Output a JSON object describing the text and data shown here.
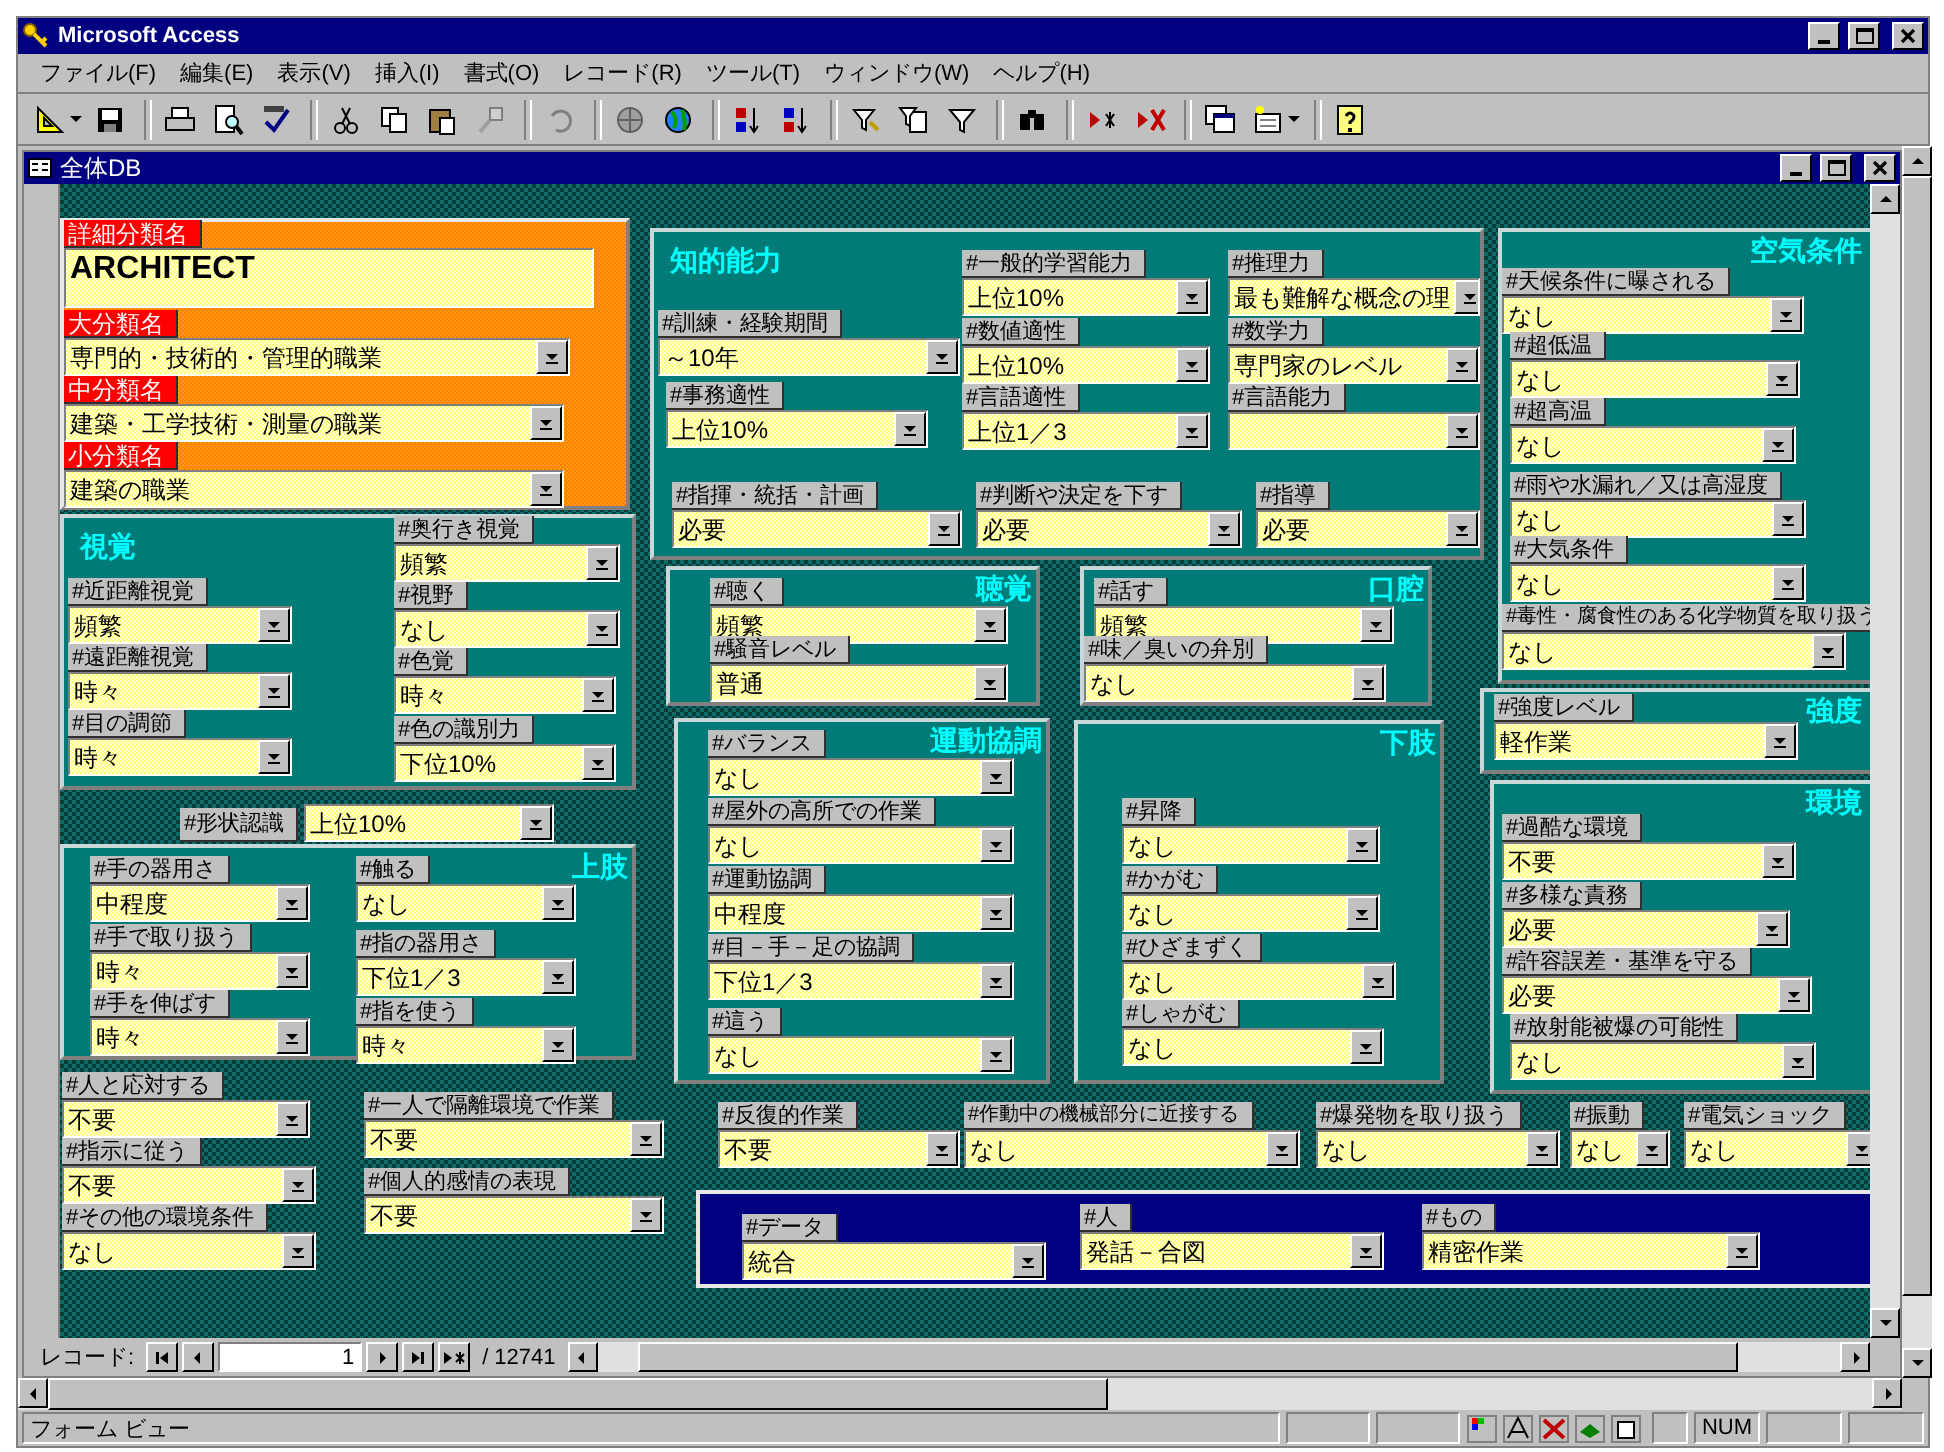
{
  "app": {
    "title": "Microsoft Access"
  },
  "menu": [
    "ファイル(F)",
    "編集(E)",
    "表示(V)",
    "挿入(I)",
    "書式(O)",
    "レコード(R)",
    "ツール(T)",
    "ウィンドウ(W)",
    "ヘルプ(H)"
  ],
  "form_window": {
    "title": "全体DB"
  },
  "groups": [
    {
      "kind": "header",
      "fields": [
        {
          "kind": "textbox",
          "label": "詳細分類名",
          "value": "ARCHITECT"
        },
        {
          "kind": "combo",
          "label": "大分類名",
          "value": "専門的・技術的・管理的職業"
        },
        {
          "kind": "combo",
          "label": "中分類名",
          "value": "建築・工学技術・測量の職業"
        },
        {
          "kind": "combo",
          "label": "小分類名",
          "value": "建築の職業"
        }
      ]
    },
    {
      "kind": "panel",
      "title": "視覚",
      "fields": [
        {
          "kind": "combo",
          "label": "#近距離視覚",
          "value": "頻繁"
        },
        {
          "kind": "combo",
          "label": "#遠距離視覚",
          "value": "時々"
        },
        {
          "kind": "combo",
          "label": "#目の調節",
          "value": "時々"
        },
        {
          "kind": "combo",
          "label": "#奥行き視覚",
          "value": "頻繁"
        },
        {
          "kind": "combo",
          "label": "#視野",
          "value": "なし"
        },
        {
          "kind": "combo",
          "label": "#色覚",
          "value": "時々"
        },
        {
          "kind": "combo",
          "label": "#色の識別力",
          "value": "下位10%"
        }
      ]
    },
    {
      "kind": "loose",
      "fields": [
        {
          "kind": "side-combo",
          "label": "#形状認識",
          "value": "上位10%"
        }
      ]
    },
    {
      "kind": "panel",
      "title": "上肢",
      "fields": [
        {
          "kind": "combo",
          "label": "#手の器用さ",
          "value": "中程度"
        },
        {
          "kind": "combo",
          "label": "#手で取り扱う",
          "value": "時々"
        },
        {
          "kind": "combo",
          "label": "#手を伸ばす",
          "value": "時々"
        },
        {
          "kind": "combo",
          "label": "#触る",
          "value": "なし"
        },
        {
          "kind": "combo",
          "label": "#指の器用さ",
          "value": "下位1／3"
        },
        {
          "kind": "combo",
          "label": "#指を使う",
          "value": "時々"
        }
      ]
    },
    {
      "kind": "loose",
      "fields": [
        {
          "kind": "combo",
          "label": "#人と応対する",
          "value": "不要"
        },
        {
          "kind": "combo",
          "label": "#指示に従う",
          "value": "不要"
        },
        {
          "kind": "combo",
          "label": "#その他の環境条件",
          "value": "なし"
        },
        {
          "kind": "combo",
          "label": "#一人で隔離環境で作業",
          "value": "不要"
        },
        {
          "kind": "combo",
          "label": "#個人的感情の表現",
          "value": "不要"
        }
      ]
    },
    {
      "kind": "panel",
      "title": "知的能力",
      "fields": [
        {
          "kind": "combo",
          "label": "#一般的学習能力",
          "value": "上位10%"
        },
        {
          "kind": "combo",
          "label": "#推理力",
          "value": "最も難解な概念の理"
        },
        {
          "kind": "combo",
          "label": "#訓練・経験期間",
          "value": "～10年"
        },
        {
          "kind": "combo",
          "label": "#数値適性",
          "value": "上位10%"
        },
        {
          "kind": "combo",
          "label": "#数学力",
          "value": "専門家のレベル"
        },
        {
          "kind": "combo",
          "label": "#事務適性",
          "value": "上位10%"
        },
        {
          "kind": "combo",
          "label": "#言語適性",
          "value": "上位1／3"
        },
        {
          "kind": "combo",
          "label": "#言語能力"
        },
        {
          "kind": "combo",
          "label": "#指揮・統括・計画",
          "value": "必要"
        },
        {
          "kind": "combo",
          "label": "#判断や決定を下す",
          "value": "必要"
        },
        {
          "kind": "combo",
          "label": "#指導",
          "value": "必要"
        }
      ]
    },
    {
      "kind": "panel",
      "title": "聴覚",
      "fields": [
        {
          "kind": "combo",
          "label": "#聴く",
          "value": "頻繁"
        },
        {
          "kind": "combo",
          "label": "#騒音レベル",
          "value": "普通"
        }
      ]
    },
    {
      "kind": "panel",
      "title": "口腔",
      "fields": [
        {
          "kind": "combo",
          "label": "#話す",
          "value": "頻繁"
        },
        {
          "kind": "combo",
          "label": "#味／臭いの弁別",
          "value": "なし"
        }
      ]
    },
    {
      "kind": "panel",
      "title": "運動協調",
      "fields": [
        {
          "kind": "combo",
          "label": "#バランス",
          "value": "なし"
        },
        {
          "kind": "combo",
          "label": "#屋外の高所での作業",
          "value": "なし"
        },
        {
          "kind": "combo",
          "label": "#運動協調",
          "value": "中程度"
        },
        {
          "kind": "combo",
          "label": "#目－手－足の協調",
          "value": "下位1／3"
        },
        {
          "kind": "combo",
          "label": "#這う",
          "value": "なし"
        }
      ]
    },
    {
      "kind": "panel",
      "title": "下肢",
      "fields": [
        {
          "kind": "combo",
          "label": "#昇降",
          "value": "なし"
        },
        {
          "kind": "combo",
          "label": "#かがむ",
          "value": "なし"
        },
        {
          "kind": "combo",
          "label": "#ひざまずく",
          "value": "なし"
        },
        {
          "kind": "combo",
          "label": "#しゃがむ",
          "value": "なし"
        }
      ]
    },
    {
      "kind": "panel",
      "title": "空気条件",
      "fields": [
        {
          "kind": "combo",
          "label": "#天候条件に曝される",
          "value": "なし"
        },
        {
          "kind": "combo",
          "label": "#超低温",
          "value": "なし"
        },
        {
          "kind": "combo",
          "label": "#超高温",
          "value": "なし"
        },
        {
          "kind": "combo",
          "label": "#雨や水漏れ／又は高湿度",
          "value": "なし"
        },
        {
          "kind": "combo",
          "label": "#大気条件",
          "value": "なし"
        },
        {
          "kind": "combo",
          "label": "#毒性・腐食性のある化学物質を取り扱う",
          "value": "なし"
        }
      ]
    },
    {
      "kind": "panel",
      "title": "強度",
      "fields": [
        {
          "kind": "combo",
          "label": "#強度レベル",
          "value": "軽作業"
        }
      ]
    },
    {
      "kind": "panel",
      "title": "環境",
      "fields": [
        {
          "kind": "combo",
          "label": "#過酷な環境",
          "value": "不要"
        },
        {
          "kind": "combo",
          "label": "#多様な責務",
          "value": "必要"
        },
        {
          "kind": "combo",
          "label": "#許容誤差・基準を守る",
          "value": "必要"
        },
        {
          "kind": "combo",
          "label": "#放射能被爆の可能性",
          "value": "なし"
        }
      ]
    },
    {
      "kind": "loose",
      "fields": [
        {
          "kind": "combo",
          "label": "#反復的作業",
          "value": "不要"
        },
        {
          "kind": "combo",
          "label": "#作動中の機械部分に近接する",
          "value": "なし"
        },
        {
          "kind": "combo",
          "label": "#爆発物を取り扱う",
          "value": "なし"
        },
        {
          "kind": "combo",
          "label": "#振動",
          "value": "なし"
        },
        {
          "kind": "combo",
          "label": "#電気ショック",
          "value": "なし"
        }
      ]
    },
    {
      "kind": "dark",
      "fields": [
        {
          "kind": "combo",
          "label": "#データ",
          "value": "統合"
        },
        {
          "kind": "combo",
          "label": "#人",
          "value": "発話－合図"
        },
        {
          "kind": "combo",
          "label": "#もの",
          "value": "精密作業"
        }
      ]
    }
  ],
  "navigator": {
    "label": "レコード:",
    "record": "1",
    "total": "/ 12741"
  },
  "status_bar": {
    "mode": "フォーム ビュー",
    "indicator": "NUM"
  }
}
